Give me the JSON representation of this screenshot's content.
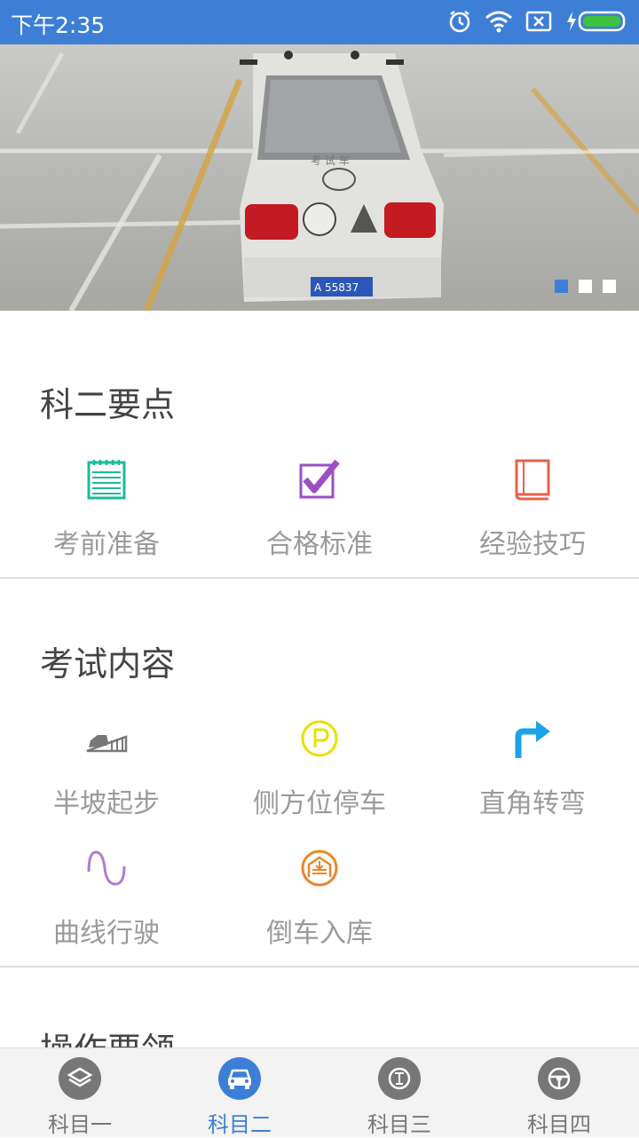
{
  "status_bar": {
    "time": "下午2:35"
  },
  "banner": {
    "plate_text": "A 55837",
    "car_roof_text": "考 试 车",
    "slide_count": 3,
    "active_slide": 1,
    "colors": {
      "active_dot": "#3d7fd6",
      "inactive_dot": "#ffffff"
    }
  },
  "section_key_points": {
    "title": "科二要点",
    "items": [
      {
        "label": "考前准备",
        "icon": "notepad-icon",
        "color": "#1fb99a"
      },
      {
        "label": "合格标准",
        "icon": "checkbox-icon",
        "color": "#9b4fc4"
      },
      {
        "label": "经验技巧",
        "icon": "book-icon",
        "color": "#e8604c"
      }
    ]
  },
  "section_exam_content": {
    "title": "考试内容",
    "items": [
      {
        "label": "半坡起步",
        "icon": "hill-start-icon",
        "color": "#777777"
      },
      {
        "label": "侧方位停车",
        "icon": "parking-icon",
        "color": "#e8e000"
      },
      {
        "label": "直角转弯",
        "icon": "right-turn-icon",
        "color": "#1aa3e8"
      },
      {
        "label": "曲线行驶",
        "icon": "curve-icon",
        "color": "#b07ad0"
      },
      {
        "label": "倒车入库",
        "icon": "garage-icon",
        "color": "#e8872a"
      }
    ]
  },
  "section_operation": {
    "title": "操作要领"
  },
  "bottom_nav": {
    "items": [
      {
        "label": "科目一",
        "icon": "layers-icon"
      },
      {
        "label": "科目二",
        "icon": "car-icon"
      },
      {
        "label": "科目三",
        "icon": "road-icon"
      },
      {
        "label": "科目四",
        "icon": "steering-wheel-icon"
      }
    ],
    "active_index": 1,
    "colors": {
      "active": "#3d7fd6",
      "inactive": "#777777"
    }
  }
}
